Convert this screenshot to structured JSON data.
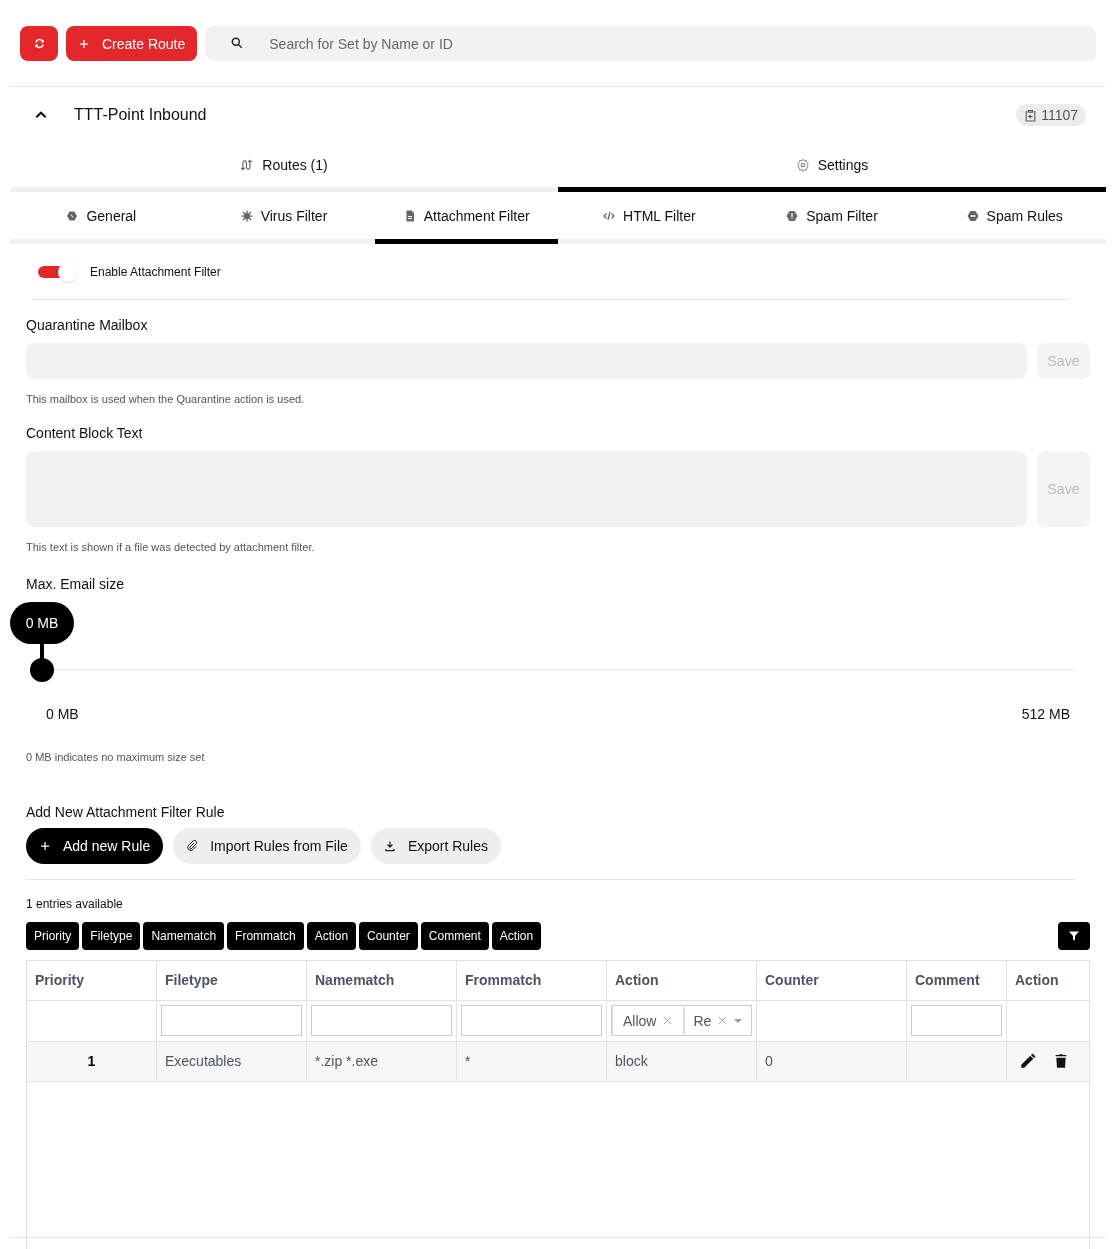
{
  "toolbar": {
    "create_button": "Create Route",
    "search": {
      "placeholder": "Search for Set by Name or ID"
    }
  },
  "set": {
    "name": "TTT-Point Inbound",
    "expanded": true,
    "id_badge": "11107"
  },
  "main_tabs": [
    {
      "label": "Routes (1)",
      "selected": false
    },
    {
      "label": "Settings",
      "selected": true
    }
  ],
  "sub_tabs": [
    {
      "label": "General",
      "selected": false
    },
    {
      "label": "Virus Filter",
      "selected": false
    },
    {
      "label": "Attachment Filter",
      "selected": true
    },
    {
      "label": "HTML Filter",
      "selected": false
    },
    {
      "label": "Spam Filter",
      "selected": false
    },
    {
      "label": "Spam Rules",
      "selected": false
    }
  ],
  "enable_toggle": {
    "label": "Enable Attachment Filter",
    "on": true
  },
  "quarantine_mailbox": {
    "label": "Quarantine Mailbox",
    "save": "Save",
    "hint": "This mailbox is used when the Quarantine action is used."
  },
  "content_block_text": {
    "label": "Content Block Text",
    "save": "Save",
    "hint": "This text is shown if a file was detected by attachment filter."
  },
  "max_email_size": {
    "label": "Max. Email size",
    "bubble": "0 MB",
    "level": 0,
    "min_label": "0 MB",
    "max_label": "512 MB",
    "hint": "0 MB indicates no maximum size set"
  },
  "rules": {
    "title": "Add New Attachment Filter Rule",
    "buttons": [
      {
        "label": "Add new Rule",
        "kind": "primary"
      },
      {
        "label": "Import Rules from File",
        "kind": "secondary"
      },
      {
        "label": "Export Rules",
        "kind": "secondary"
      }
    ]
  },
  "entries": "1 entries available",
  "column_toggles": [
    "Priority",
    "Filetype",
    "Namematch",
    "Frommatch",
    "Action",
    "Counter",
    "Comment",
    "Action"
  ],
  "table": {
    "columns": [
      {
        "label": "Priority",
        "kind": "none"
      },
      {
        "label": "Filetype",
        "kind": "text"
      },
      {
        "label": "Namematch",
        "kind": "text"
      },
      {
        "label": "Frommatch",
        "kind": "text"
      },
      {
        "label": "Action",
        "kind": "tags",
        "tags": [
          "Allow",
          "Re"
        ]
      },
      {
        "label": "Counter",
        "kind": "none"
      },
      {
        "label": "Comment",
        "kind": "text"
      },
      {
        "label": "Action",
        "kind": "none"
      }
    ],
    "rows": [
      {
        "priority": "1",
        "filetype": "Executables",
        "namematch": "*.zip *.exe",
        "frommatch": "*",
        "action": "block",
        "counter": "0"
      }
    ]
  }
}
